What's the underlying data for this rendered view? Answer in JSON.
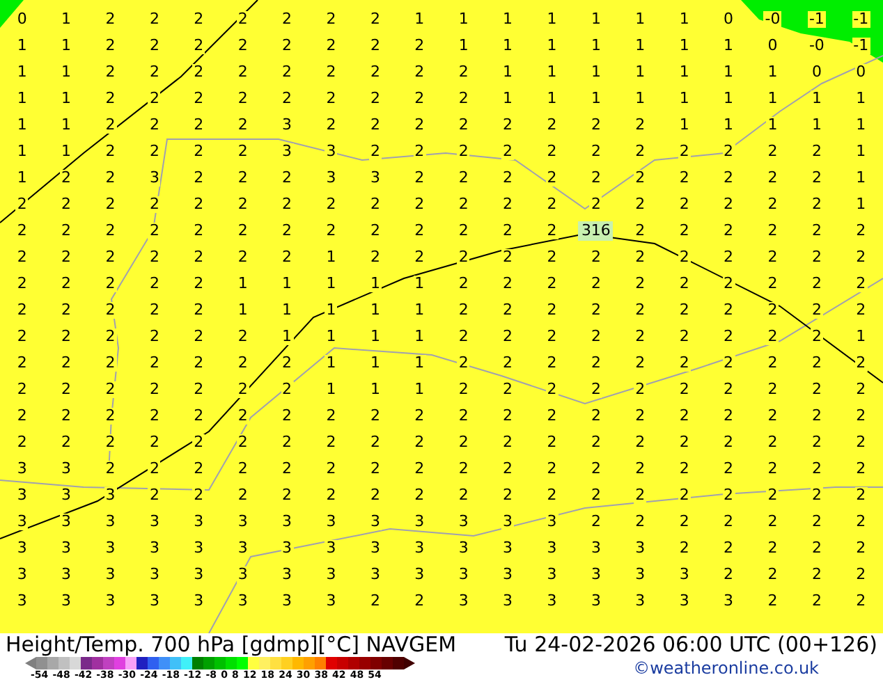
{
  "map": {
    "rows": [
      [
        "0",
        "1",
        "2",
        "2",
        "2",
        "2",
        "2",
        "2",
        "2",
        "1",
        "1",
        "1",
        "1",
        "1",
        "1",
        "1",
        "0",
        "-0",
        "-1",
        "-1"
      ],
      [
        "1",
        "1",
        "2",
        "2",
        "2",
        "2",
        "2",
        "2",
        "2",
        "2",
        "1",
        "1",
        "1",
        "1",
        "1",
        "1",
        "1",
        "0",
        "-0",
        "-1"
      ],
      [
        "1",
        "1",
        "2",
        "2",
        "2",
        "2",
        "2",
        "2",
        "2",
        "2",
        "2",
        "1",
        "1",
        "1",
        "1",
        "1",
        "1",
        "1",
        "0",
        "0"
      ],
      [
        "1",
        "1",
        "2",
        "2",
        "2",
        "2",
        "2",
        "2",
        "2",
        "2",
        "2",
        "1",
        "1",
        "1",
        "1",
        "1",
        "1",
        "1",
        "1",
        "1"
      ],
      [
        "1",
        "1",
        "2",
        "2",
        "2",
        "2",
        "3",
        "2",
        "2",
        "2",
        "2",
        "2",
        "2",
        "2",
        "2",
        "1",
        "1",
        "1",
        "1",
        "1"
      ],
      [
        "1",
        "1",
        "2",
        "2",
        "2",
        "2",
        "3",
        "3",
        "2",
        "2",
        "2",
        "2",
        "2",
        "2",
        "2",
        "2",
        "2",
        "2",
        "2",
        "1"
      ],
      [
        "1",
        "2",
        "2",
        "3",
        "2",
        "2",
        "2",
        "3",
        "3",
        "2",
        "2",
        "2",
        "2",
        "2",
        "2",
        "2",
        "2",
        "2",
        "2",
        "1"
      ],
      [
        "2",
        "2",
        "2",
        "2",
        "2",
        "2",
        "2",
        "2",
        "2",
        "2",
        "2",
        "2",
        "2",
        "2",
        "2",
        "2",
        "2",
        "2",
        "2",
        "1"
      ],
      [
        "2",
        "2",
        "2",
        "2",
        "2",
        "2",
        "2",
        "2",
        "2",
        "2",
        "2",
        "2",
        "2",
        {
          "kind": "contour-label",
          "text": "316"
        },
        "2",
        "2",
        "2",
        "2",
        "2",
        "2"
      ],
      [
        "2",
        "2",
        "2",
        "2",
        "2",
        "2",
        "2",
        "1",
        "2",
        "2",
        "2",
        "2",
        "2",
        "2",
        "2",
        "2",
        "2",
        "2",
        "2",
        "2"
      ],
      [
        "2",
        "2",
        "2",
        "2",
        "2",
        "1",
        "1",
        "1",
        "1",
        "1",
        "2",
        "2",
        "2",
        "2",
        "2",
        "2",
        "2",
        "2",
        "2",
        "2"
      ],
      [
        "2",
        "2",
        "2",
        "2",
        "2",
        "1",
        "1",
        "1",
        "1",
        "1",
        "2",
        "2",
        "2",
        "2",
        "2",
        "2",
        "2",
        "2",
        "2",
        "2"
      ],
      [
        "2",
        "2",
        "2",
        "2",
        "2",
        "2",
        "1",
        "1",
        "1",
        "1",
        "2",
        "2",
        "2",
        "2",
        "2",
        "2",
        "2",
        "2",
        "2",
        "1"
      ],
      [
        "2",
        "2",
        "2",
        "2",
        "2",
        "2",
        "2",
        "1",
        "1",
        "1",
        "2",
        "2",
        "2",
        "2",
        "2",
        "2",
        "2",
        "2",
        "2",
        "2"
      ],
      [
        "2",
        "2",
        "2",
        "2",
        "2",
        "2",
        "2",
        "1",
        "1",
        "1",
        "2",
        "2",
        "2",
        "2",
        "2",
        "2",
        "2",
        "2",
        "2",
        "2"
      ],
      [
        "2",
        "2",
        "2",
        "2",
        "2",
        "2",
        "2",
        "2",
        "2",
        "2",
        "2",
        "2",
        "2",
        "2",
        "2",
        "2",
        "2",
        "2",
        "2",
        "2"
      ],
      [
        "2",
        "2",
        "2",
        "2",
        "2",
        "2",
        "2",
        "2",
        "2",
        "2",
        "2",
        "2",
        "2",
        "2",
        "2",
        "2",
        "2",
        "2",
        "2",
        "2"
      ],
      [
        "3",
        "3",
        "2",
        "2",
        "2",
        "2",
        "2",
        "2",
        "2",
        "2",
        "2",
        "2",
        "2",
        "2",
        "2",
        "2",
        "2",
        "2",
        "2",
        "2"
      ],
      [
        "3",
        "3",
        "3",
        "2",
        "2",
        "2",
        "2",
        "2",
        "2",
        "2",
        "2",
        "2",
        "2",
        "2",
        "2",
        "2",
        "2",
        "2",
        "2",
        "2"
      ],
      [
        "3",
        "3",
        "3",
        "3",
        "3",
        "3",
        "3",
        "3",
        "3",
        "3",
        "3",
        "3",
        "3",
        "2",
        "2",
        "2",
        "2",
        "2",
        "2",
        "2"
      ],
      [
        "3",
        "3",
        "3",
        "3",
        "3",
        "3",
        "3",
        "3",
        "3",
        "3",
        "3",
        "3",
        "3",
        "3",
        "3",
        "2",
        "2",
        "2",
        "2",
        "2"
      ],
      [
        "3",
        "3",
        "3",
        "3",
        "3",
        "3",
        "3",
        "3",
        "3",
        "3",
        "3",
        "3",
        "3",
        "3",
        "3",
        "3",
        "2",
        "2",
        "2",
        "2"
      ],
      [
        "3",
        "3",
        "3",
        "3",
        "3",
        "3",
        "3",
        "3",
        "2",
        "2",
        "3",
        "3",
        "3",
        "3",
        "3",
        "3",
        "3",
        "2",
        "2",
        "2"
      ]
    ]
  },
  "footer": {
    "title": "Height/Temp. 700 hPa [gdmp][°C] NAVGEM",
    "valid_time": "Tu 24-02-2026 06:00 UTC (00+126)",
    "credit": "©weatheronline.co.uk",
    "legend": {
      "swatches": [
        {
          "color": "#909090"
        },
        {
          "color": "#a8a8a8"
        },
        {
          "color": "#c0c0c0"
        },
        {
          "color": "#d8d8d8"
        },
        {
          "color": "#7a2a8a"
        },
        {
          "color": "#a030a0"
        },
        {
          "color": "#c040c0"
        },
        {
          "color": "#e040e0"
        },
        {
          "color": "#f8a0f8"
        },
        {
          "color": "#2020c0"
        },
        {
          "color": "#3060f0"
        },
        {
          "color": "#4090f8"
        },
        {
          "color": "#40c0f8"
        },
        {
          "color": "#40f0f8"
        },
        {
          "color": "#008000"
        },
        {
          "color": "#00a000"
        },
        {
          "color": "#00c000"
        },
        {
          "color": "#00e000"
        },
        {
          "color": "#00ff00"
        },
        {
          "color": "#ffff40"
        },
        {
          "color": "#fff060"
        },
        {
          "color": "#ffe040"
        },
        {
          "color": "#ffd020"
        },
        {
          "color": "#ffb800"
        },
        {
          "color": "#ffa000"
        },
        {
          "color": "#ff8000"
        },
        {
          "color": "#e00000"
        },
        {
          "color": "#c80000"
        },
        {
          "color": "#b00000"
        },
        {
          "color": "#980000"
        },
        {
          "color": "#800000"
        },
        {
          "color": "#680000"
        },
        {
          "color": "#500000"
        }
      ],
      "ticks": [
        "-54",
        "-48",
        "-42",
        "-38",
        "-30",
        "-24",
        "-18",
        "-12",
        "-8",
        "0",
        "8",
        "12",
        "18",
        "24",
        "30",
        "38",
        "42",
        "48",
        "54"
      ]
    }
  }
}
